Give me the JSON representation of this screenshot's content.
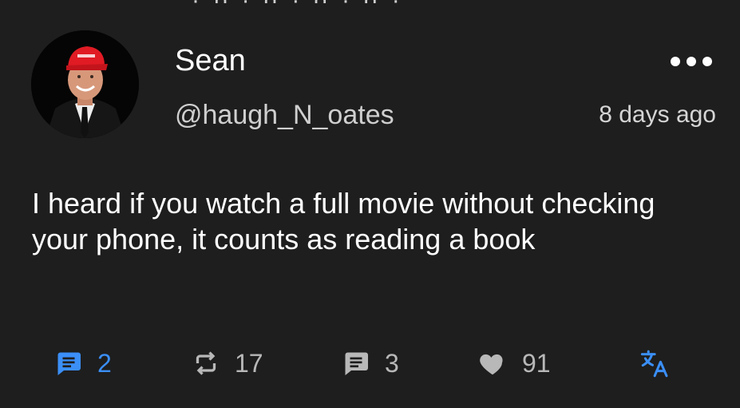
{
  "post": {
    "display_name": "Sean",
    "handle": "@haugh_N_oates",
    "timestamp": "8 days ago",
    "body": "I heard if you watch a full movie without checking your phone, it counts as reading a book",
    "more_icon": "more-horizontal-icon",
    "avatar_icon": "user-avatar-photo"
  },
  "actions": {
    "replies": {
      "count": "2",
      "icon": "comment-icon",
      "color": "#3b8ff7"
    },
    "reposts": {
      "count": "17",
      "icon": "repost-icon",
      "color": "#b8b8b8"
    },
    "quotes": {
      "count": "3",
      "icon": "quote-comment-icon",
      "color": "#b8b8b8"
    },
    "likes": {
      "count": "91",
      "icon": "heart-icon",
      "color": "#b8b8b8"
    },
    "translate": {
      "icon": "translate-icon",
      "color": "#3b8ff7"
    }
  },
  "theme": {
    "background": "#1e1e1e",
    "text_primary": "#ffffff",
    "text_secondary": "#cfcfcf",
    "accent": "#3b8ff7"
  }
}
